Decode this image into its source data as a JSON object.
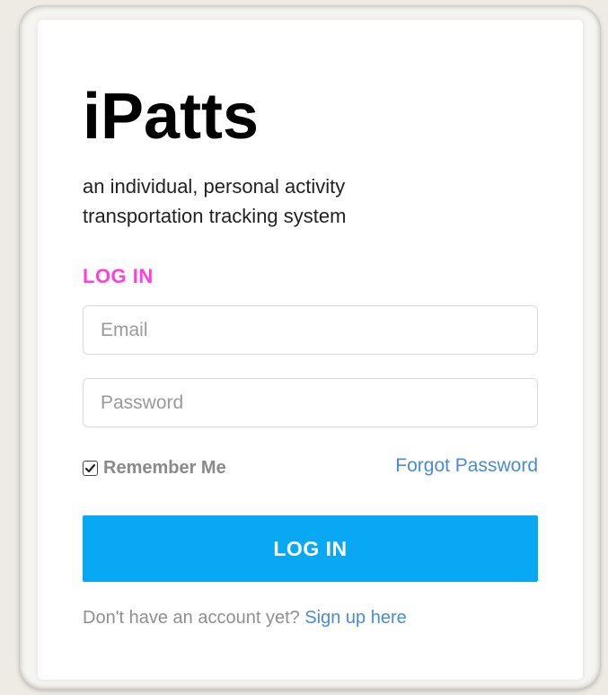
{
  "app": {
    "title": "iPatts",
    "tagline": "an individual, personal activity transportation tracking system"
  },
  "login_form": {
    "heading": "LOG IN",
    "email": {
      "value": "",
      "placeholder": "Email"
    },
    "password": {
      "value": "",
      "placeholder": "Password"
    },
    "remember_me": {
      "label": "Remember Me",
      "checked": true
    },
    "forgot_password_label": "Forgot Password",
    "submit_label": "LOG IN",
    "signup_prompt": "Don't have an account yet?",
    "signup_link_label": "Sign up here"
  },
  "colors": {
    "accent_heading": "#ff3fd8",
    "button": "#08a8f4",
    "link": "#4a8bd6"
  },
  "icons": {
    "checkbox_check": "check-icon"
  }
}
